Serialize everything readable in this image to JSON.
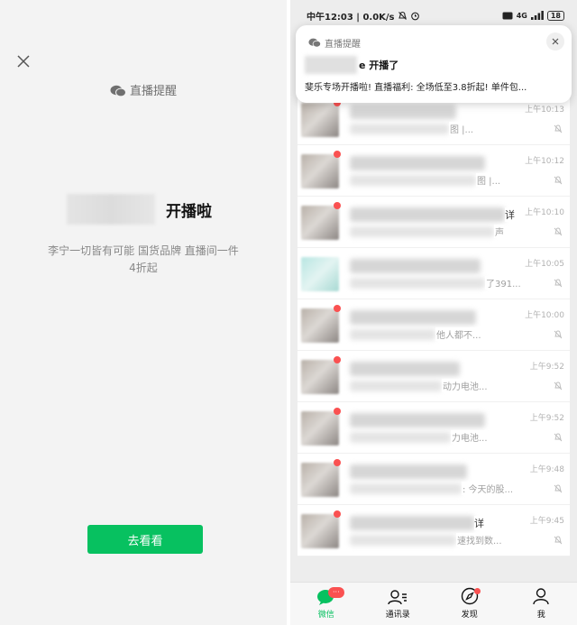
{
  "left": {
    "header": "直播提醒",
    "live_label": "开播啦",
    "description": "李宁一切皆有可能 国货品牌 直播间一件4折起",
    "button": "去看看"
  },
  "status_bar": {
    "time_speed": "中午12:03 | 0.0K/s",
    "network": "4G",
    "battery": "18"
  },
  "notification": {
    "header": "直播提醒",
    "title_suffix": "e 开播了",
    "body": "斐乐专场开播啦! 直播福利: 全场低至3.8折起! 单件包..."
  },
  "chats": [
    {
      "time": "上午10:13",
      "tail_title": "",
      "tail_msg": "图 |..."
    },
    {
      "time": "上午10:12",
      "tail_title": "",
      "tail_msg": "图 |..."
    },
    {
      "time": "上午10:10",
      "tail_title": "详",
      "tail_msg": "声"
    },
    {
      "time": "上午10:05",
      "tail_title": "",
      "tail_msg": "了391..."
    },
    {
      "time": "上午10:00",
      "tail_title": "",
      "tail_msg": "他人都不..."
    },
    {
      "time": "上午9:52",
      "tail_title": "",
      "tail_msg": "动力电池..."
    },
    {
      "time": "上午9:52",
      "tail_title": "",
      "tail_msg": "力电池..."
    },
    {
      "time": "上午9:48",
      "tail_title": "",
      "tail_msg": ": 今天的股..."
    },
    {
      "time": "上午9:45",
      "tail_title": "详",
      "tail_msg": "速找到数..."
    }
  ],
  "tabs": [
    {
      "label": "微信",
      "icon": "chat-bubble-icon",
      "badge": "···"
    },
    {
      "label": "通讯录",
      "icon": "contacts-icon"
    },
    {
      "label": "发现",
      "icon": "compass-icon"
    },
    {
      "label": "我",
      "icon": "person-icon"
    }
  ],
  "colors": {
    "accent": "#07c160",
    "badge": "#fa5151"
  }
}
